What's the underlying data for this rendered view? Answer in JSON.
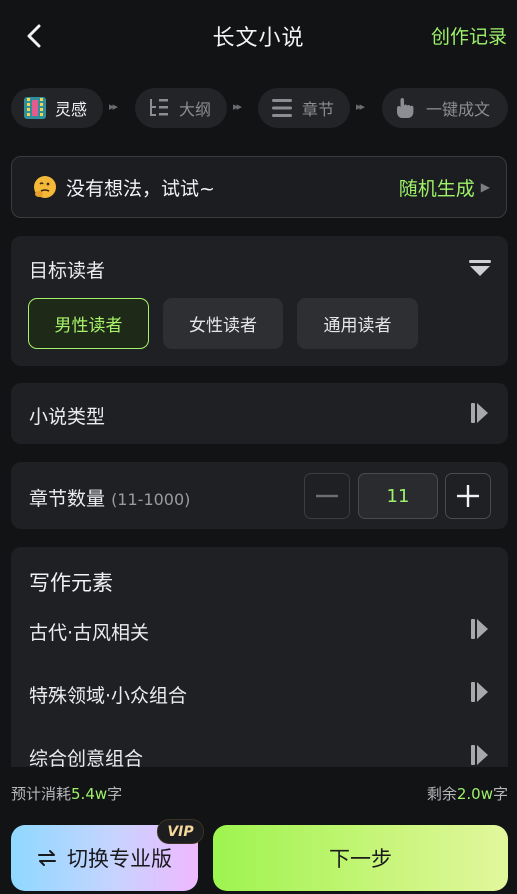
{
  "header": {
    "title": "长文小说",
    "history_label": "创作记录"
  },
  "steps": [
    {
      "label": "灵感",
      "icon": "film-icon",
      "active": true
    },
    {
      "label": "大纲",
      "icon": "outline-icon",
      "active": false
    },
    {
      "label": "章节",
      "icon": "chapters-icon",
      "active": false
    },
    {
      "label": "一键成文",
      "icon": "hand-tap-icon",
      "active": false
    }
  ],
  "idea": {
    "prompt": "没有想法，试试~",
    "random_label": "随机生成"
  },
  "reader": {
    "label": "目标读者",
    "options": [
      "男性读者",
      "女性读者",
      "通用读者"
    ],
    "selected": "男性读者"
  },
  "novel_type": {
    "label": "小说类型"
  },
  "chapter_count": {
    "label": "章节数量",
    "range": "(11-1000)",
    "value": "11"
  },
  "elements": {
    "title": "写作元素",
    "items": [
      "古代·古风相关",
      "特殊领域·小众组合",
      "综合创意组合"
    ]
  },
  "footer": {
    "estimate_prefix": "预计消耗",
    "estimate_value": "5.4w",
    "estimate_suffix": "字",
    "remaining_prefix": "剩余",
    "remaining_value": "2.0w",
    "remaining_suffix": "字"
  },
  "actions": {
    "pro_label": "切换专业版",
    "vip_badge": "VIP",
    "next_label": "下一步"
  },
  "colors": {
    "accent": "#9ef26a",
    "background": "#121315",
    "card": "#1f2023"
  }
}
